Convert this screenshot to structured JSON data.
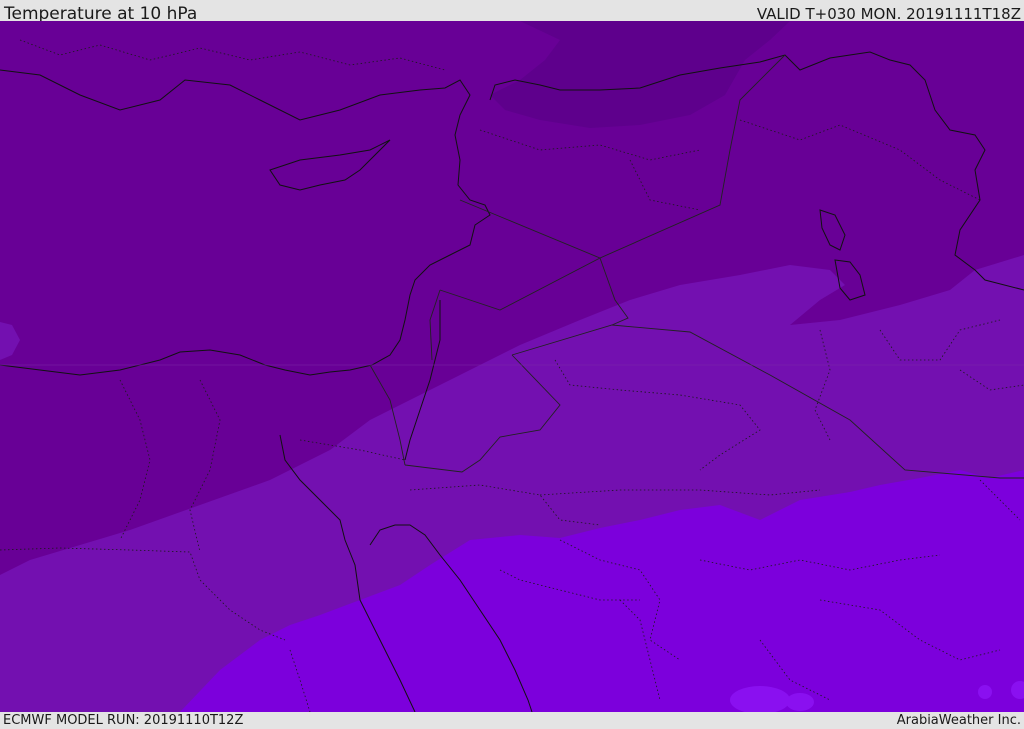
{
  "header": {
    "title": "Temperature at 10 hPa",
    "valid_time": "VALID T+030 MON. 20191111T18Z"
  },
  "footer": {
    "model_run": "ECMWF MODEL RUN: 20191110T12Z",
    "credit": "ArabiaWeather Inc."
  },
  "map": {
    "variable": "temperature",
    "level": "10 hPa",
    "colors": {
      "band_darkest": "#5e008c",
      "band_dark": "#680096",
      "band_mid": "#7310b0",
      "band_light": "#7c00dc",
      "band_lightest": "#8a10f0",
      "coastline": "#111111",
      "border": "#222222"
    }
  }
}
